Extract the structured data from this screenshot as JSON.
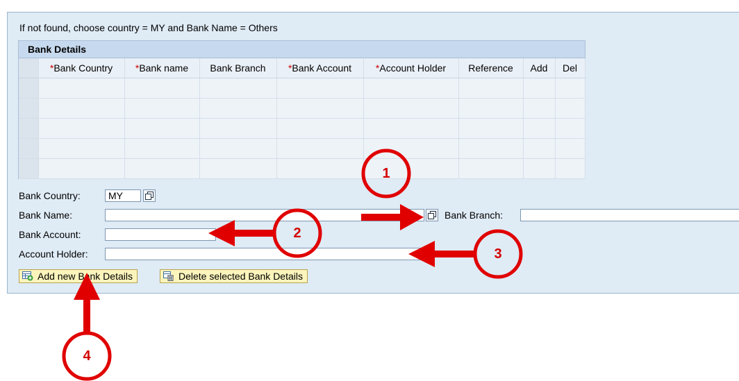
{
  "hint": "If not found, choose country = MY and Bank Name = Others",
  "table": {
    "title": "Bank Details",
    "columns": [
      {
        "label": "Bank Country",
        "required": true
      },
      {
        "label": "Bank name",
        "required": true
      },
      {
        "label": "Bank Branch",
        "required": false
      },
      {
        "label": "Bank Account",
        "required": true
      },
      {
        "label": "Account Holder",
        "required": true
      },
      {
        "label": "Reference",
        "required": false
      },
      {
        "label": "Add",
        "required": false
      },
      {
        "label": "Del",
        "required": false
      }
    ],
    "required_marker": "*",
    "empty_rows": 5
  },
  "form": {
    "bank_country_label": "Bank Country:",
    "bank_country_value": "MY",
    "bank_name_label": "Bank Name:",
    "bank_name_value": "",
    "bank_branch_label": "Bank Branch:",
    "bank_branch_value": "",
    "bank_account_label": "Bank Account:",
    "bank_account_value": "",
    "account_holder_label": "Account Holder:",
    "account_holder_value": ""
  },
  "buttons": {
    "add_label": "Add new Bank Details",
    "delete_label": "Delete selected Bank Details"
  },
  "annotations": {
    "marker_1": "1",
    "marker_2": "2",
    "marker_3": "3",
    "marker_4": "4",
    "color": "#e00000"
  }
}
